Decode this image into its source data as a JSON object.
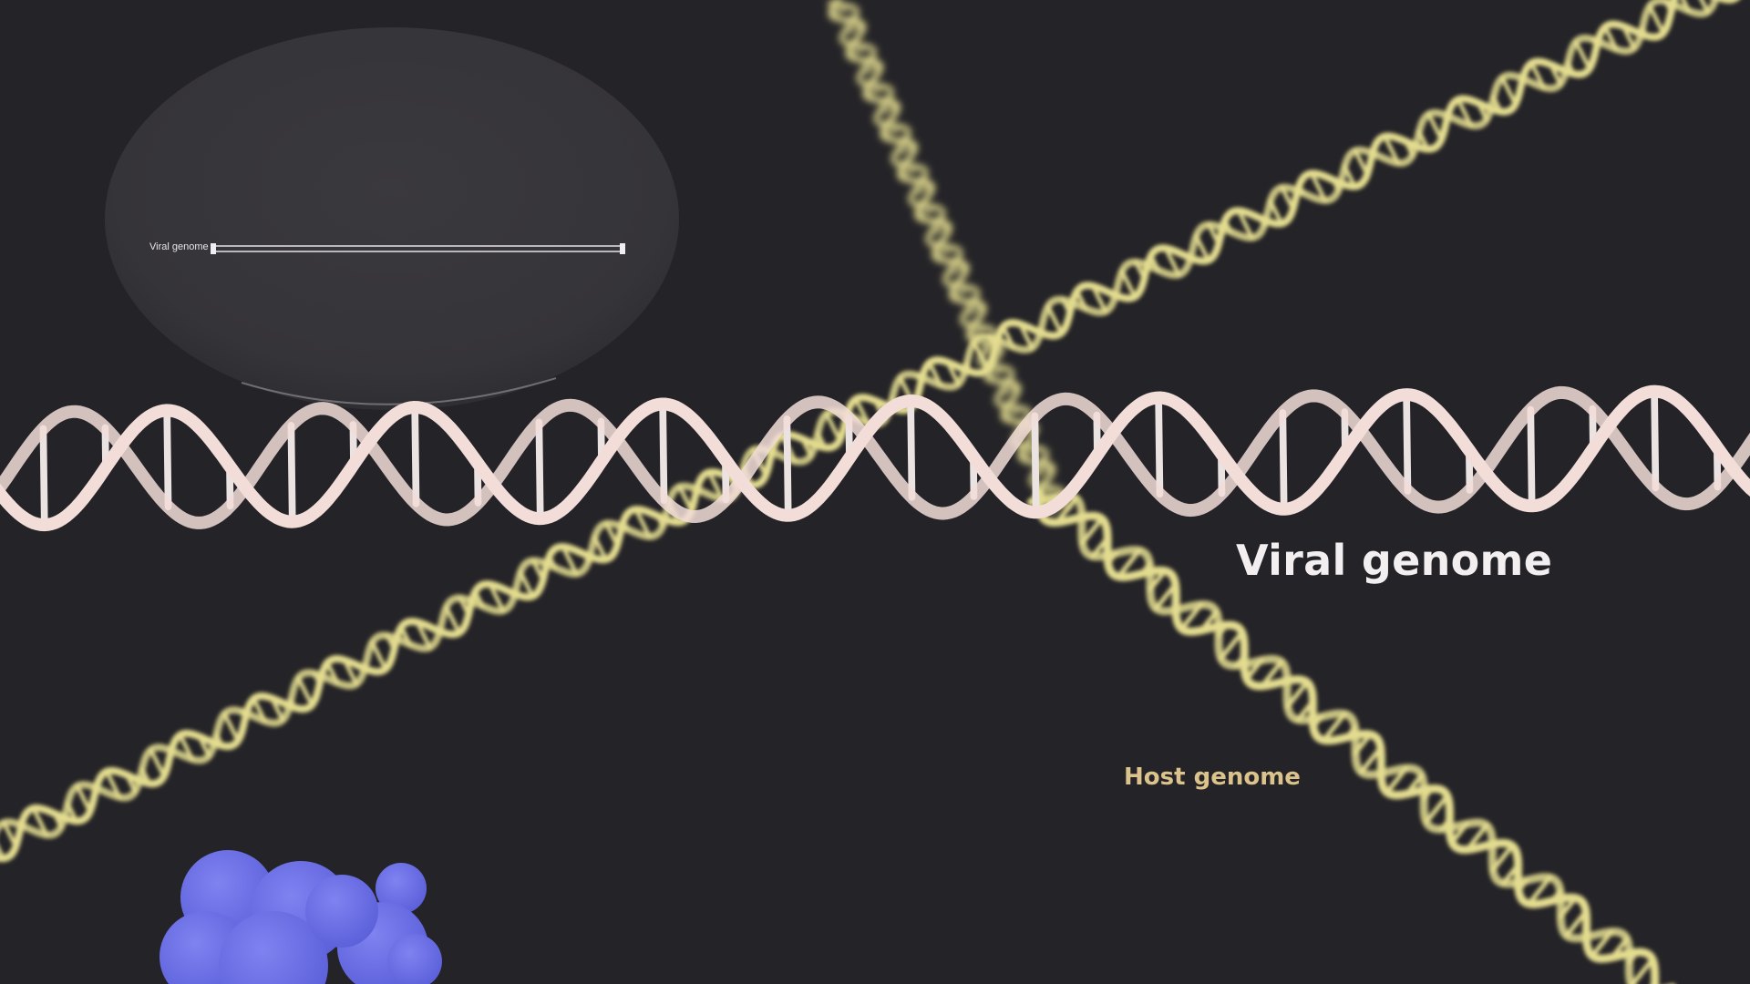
{
  "inset": {
    "label": "Viral genome"
  },
  "labels": {
    "viral_genome": "Viral genome",
    "host_genome": "Host genome"
  },
  "colors": {
    "background": "#242327",
    "viral_dna": "#f2ddd8",
    "host_dna": "#e3dc8f",
    "host_label": "#dcc38c",
    "protein": "#6b6fe6",
    "inset_bubble": "#3a393c"
  },
  "icons": {
    "protein": "protein-blob"
  }
}
